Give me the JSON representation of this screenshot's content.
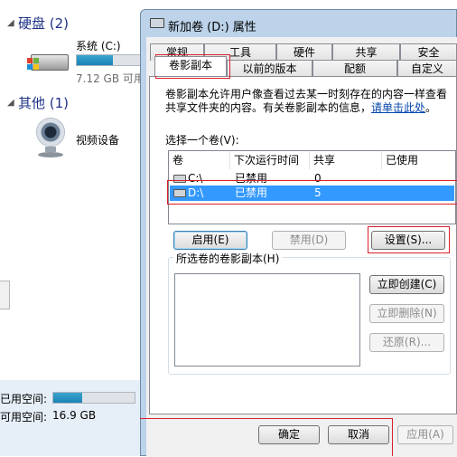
{
  "explorer": {
    "section_hdd": {
      "arrow": "◢",
      "label": "硬盘 (2)"
    },
    "drive_c": {
      "name": "系统 (C:)",
      "size_text": "7.12 GB 可用",
      "fill_fraction": 0.55
    },
    "section_other": {
      "arrow": "◢",
      "label": "其他 (1)"
    },
    "video_device": {
      "label": "视频设备"
    },
    "status": {
      "used_label": "已用空间:",
      "used_fraction": 0.35,
      "free_label": "可用空间:",
      "free_value": "16.9 GB"
    }
  },
  "dialog": {
    "title": "新加卷 (D:) 属性",
    "tabs_row1": [
      "常规",
      "工具",
      "硬件",
      "共享",
      "安全"
    ],
    "tabs_row2": [
      "卷影副本",
      "以前的版本",
      "配额",
      "自定义"
    ],
    "description": "卷影副本允许用户像查看过去某一时刻存在的内容一样查看",
    "description_line2": "共享文件夹的内容。有关卷影副本的信息，",
    "description_link": "请单击此处",
    "description_end": "。",
    "select_label": "选择一个卷(V):",
    "columns": [
      "卷",
      "下次运行时间",
      "共享",
      "已使用"
    ],
    "volumes": [
      {
        "name": "C:\\",
        "next_run": "已禁用",
        "shares": "0",
        "used": ""
      },
      {
        "name": "D:\\",
        "next_run": "已禁用",
        "shares": "5",
        "used": ""
      }
    ],
    "selected_volume": "D:\\",
    "buttons": {
      "enable": "启用(E)",
      "disable": "禁用(D)",
      "settings": "设置(S)...",
      "create_now": "立即创建(C)",
      "delete_now": "立即删除(N)",
      "revert": "还原(R)...",
      "ok": "确定",
      "cancel": "取消",
      "apply": "应用(A)"
    },
    "copies_label": "所选卷的卷影副本(H)"
  },
  "colors": {
    "highlight": "#d9202a",
    "selection": "#3399ff",
    "title_bar": "#bcd3ea"
  }
}
